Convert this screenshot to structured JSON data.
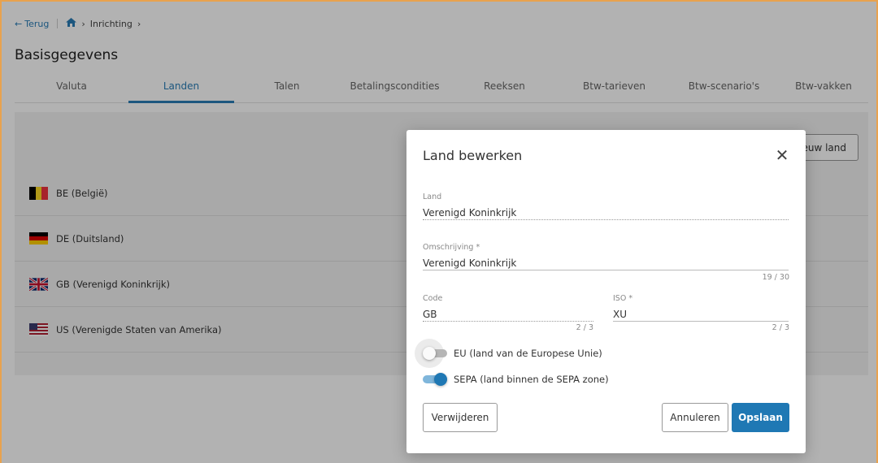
{
  "breadcrumb": {
    "back_label": "Terug",
    "crumb": "Inrichting"
  },
  "page_title": "Basisgegevens",
  "tabs": [
    {
      "label": "Valuta"
    },
    {
      "label": "Landen"
    },
    {
      "label": "Talen"
    },
    {
      "label": "Betalingscondities"
    },
    {
      "label": "Reeksen"
    },
    {
      "label": "Btw-tarieven"
    },
    {
      "label": "Btw-scenario's"
    },
    {
      "label": "Btw-vakken"
    }
  ],
  "active_tab": "Landen",
  "list": {
    "new_button_label": "euw land",
    "countries": [
      {
        "label": "BE (België)",
        "flag": "belgium-flag-icon"
      },
      {
        "label": "DE (Duitsland)",
        "flag": "germany-flag-icon"
      },
      {
        "label": "GB (Verenigd Koninkrijk)",
        "flag": "uk-flag-icon"
      },
      {
        "label": "US (Verenigde Staten van Amerika)",
        "flag": "usa-flag-icon"
      }
    ]
  },
  "modal": {
    "title": "Land bewerken",
    "land": {
      "label": "Land",
      "value": "Verenigd Koninkrijk"
    },
    "omschrijving": {
      "label": "Omschrijving *",
      "value": "Verenigd Koninkrijk",
      "counter": "19 / 30"
    },
    "code": {
      "label": "Code",
      "value": "GB",
      "counter": "2 / 3"
    },
    "iso": {
      "label": "ISO *",
      "value": "XU",
      "counter": "2 / 3"
    },
    "eu_toggle": {
      "label": "EU (land van de Europese Unie)",
      "checked": false
    },
    "sepa_toggle": {
      "label": "SEPA (land binnen de SEPA zone)",
      "checked": true
    },
    "delete_button": "Verwijderen",
    "cancel_button": "Annuleren",
    "save_button": "Opslaan"
  },
  "colors": {
    "accent": "#1f78b4",
    "frame": "#e8a24e",
    "overlay": "rgba(0,0,0,0.3)"
  }
}
